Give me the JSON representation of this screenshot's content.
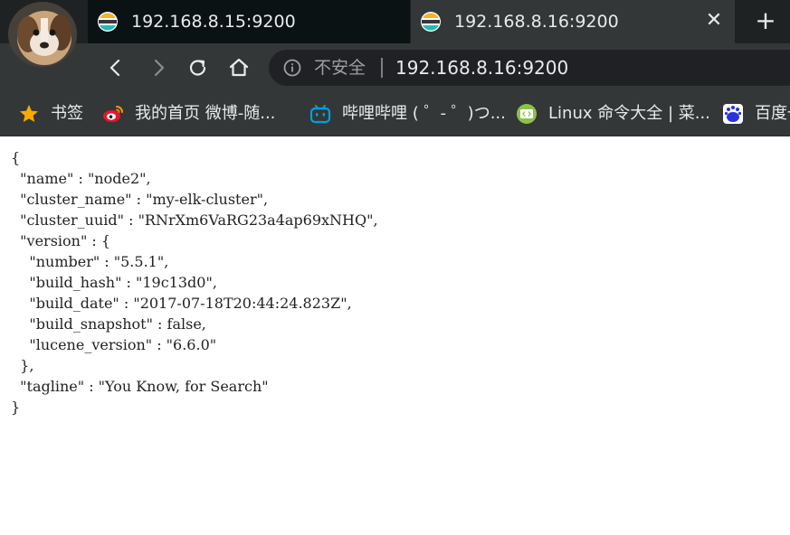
{
  "tabs": [
    {
      "title": "192.168.8.15:9200",
      "active": false
    },
    {
      "title": "192.168.8.16:9200",
      "active": true,
      "close_symbol": "✕"
    }
  ],
  "new_tab_symbol": "+",
  "toolbar": {
    "security_label": "不安全",
    "url": "192.168.8.16:9200"
  },
  "bookmarks": [
    {
      "label": "书签",
      "icon": "star-icon"
    },
    {
      "label": "我的首页 微博-随...",
      "icon": "weibo-icon"
    },
    {
      "label": "哔哩哔哩 ( ゜- ゜)つ...",
      "icon": "bilibili-icon"
    },
    {
      "label": "Linux 命令大全 | 菜...",
      "icon": "runoob-icon"
    },
    {
      "label": "百度一",
      "icon": "baidu-icon"
    }
  ],
  "json_lines": [
    "{",
    "  \"name\" : \"node2\",",
    "  \"cluster_name\" : \"my-elk-cluster\",",
    "  \"cluster_uuid\" : \"RNrXm6VaRG23a4ap69xNHQ\",",
    "  \"version\" : {",
    "    \"number\" : \"5.5.1\",",
    "    \"build_hash\" : \"19c13d0\",",
    "    \"build_date\" : \"2017-07-18T20:44:24.823Z\",",
    "    \"build_snapshot\" : false,",
    "    \"lucene_version\" : \"6.6.0\"",
    "  },",
    "  \"tagline\" : \"You Know, for Search\"",
    "}"
  ],
  "colors": {
    "tab_strip": "#1e2223",
    "toolbar": "#333738",
    "omnibox": "#202124",
    "text_light": "#e8eaed",
    "star": "#f9ab00",
    "weibo": "#e6162d",
    "bilibili": "#00a1d6",
    "runoob": "#8bc34a",
    "baidu": "#2932e1"
  }
}
